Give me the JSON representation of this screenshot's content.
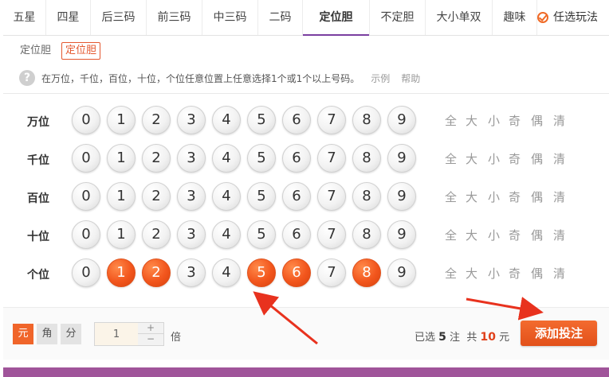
{
  "tabs": [
    {
      "label": "五星"
    },
    {
      "label": "四星"
    },
    {
      "label": "后三码"
    },
    {
      "label": "前三码"
    },
    {
      "label": "中三码"
    },
    {
      "label": "二码"
    },
    {
      "label": "定位胆"
    },
    {
      "label": "不定胆"
    },
    {
      "label": "大小单双"
    },
    {
      "label": "趣味"
    }
  ],
  "active_tab": "定位胆",
  "optional_play_label": "任选玩法",
  "subtabs": [
    {
      "label": "定位胆"
    },
    {
      "label": "定位胆"
    }
  ],
  "hint": {
    "text": "在万位，千位，百位，十位，个位任意位置上任意选择1个或1个以上号码。",
    "example_link": "示例",
    "help_link": "帮助"
  },
  "quick_buttons": [
    "全",
    "大",
    "小",
    "奇",
    "偶",
    "清"
  ],
  "rows": [
    {
      "label": "万位",
      "selected": []
    },
    {
      "label": "千位",
      "selected": []
    },
    {
      "label": "百位",
      "selected": []
    },
    {
      "label": "十位",
      "selected": []
    },
    {
      "label": "个位",
      "selected": [
        1,
        2,
        5,
        6,
        8
      ]
    }
  ],
  "digits": [
    "0",
    "1",
    "2",
    "3",
    "4",
    "5",
    "6",
    "7",
    "8",
    "9"
  ],
  "units": [
    {
      "label": "元",
      "active": true
    },
    {
      "label": "角",
      "active": false
    },
    {
      "label": "分",
      "active": false
    }
  ],
  "multiplier": {
    "value": "1",
    "plus": "+",
    "minus": "−",
    "label": "倍"
  },
  "summary": {
    "selected_prefix": "已选",
    "count": "5",
    "count_suffix": "注",
    "total_prefix": "共",
    "amount": "10",
    "amount_suffix": "元"
  },
  "add_button": "添加投注",
  "colors": {
    "accent": "#f0652a",
    "tab_underline": "#7a3fa0",
    "arrow": "#e8321e"
  }
}
